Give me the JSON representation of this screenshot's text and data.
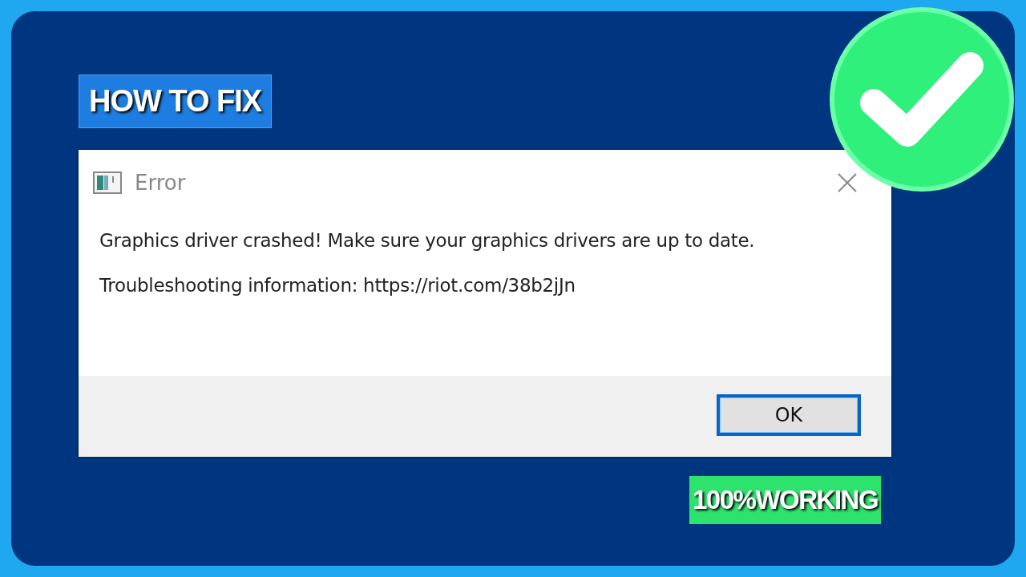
{
  "banner": {
    "text": "HOW TO FIX"
  },
  "dialog": {
    "title": "Error",
    "messages": [
      "Graphics driver crashed! Make sure your graphics drivers are up to date.",
      "Troubleshooting information: https://riot.com/38b2jJn"
    ],
    "buttons": [
      {
        "label": "OK",
        "focused": true
      }
    ]
  },
  "badge": {
    "text": "100%WORKING"
  }
}
